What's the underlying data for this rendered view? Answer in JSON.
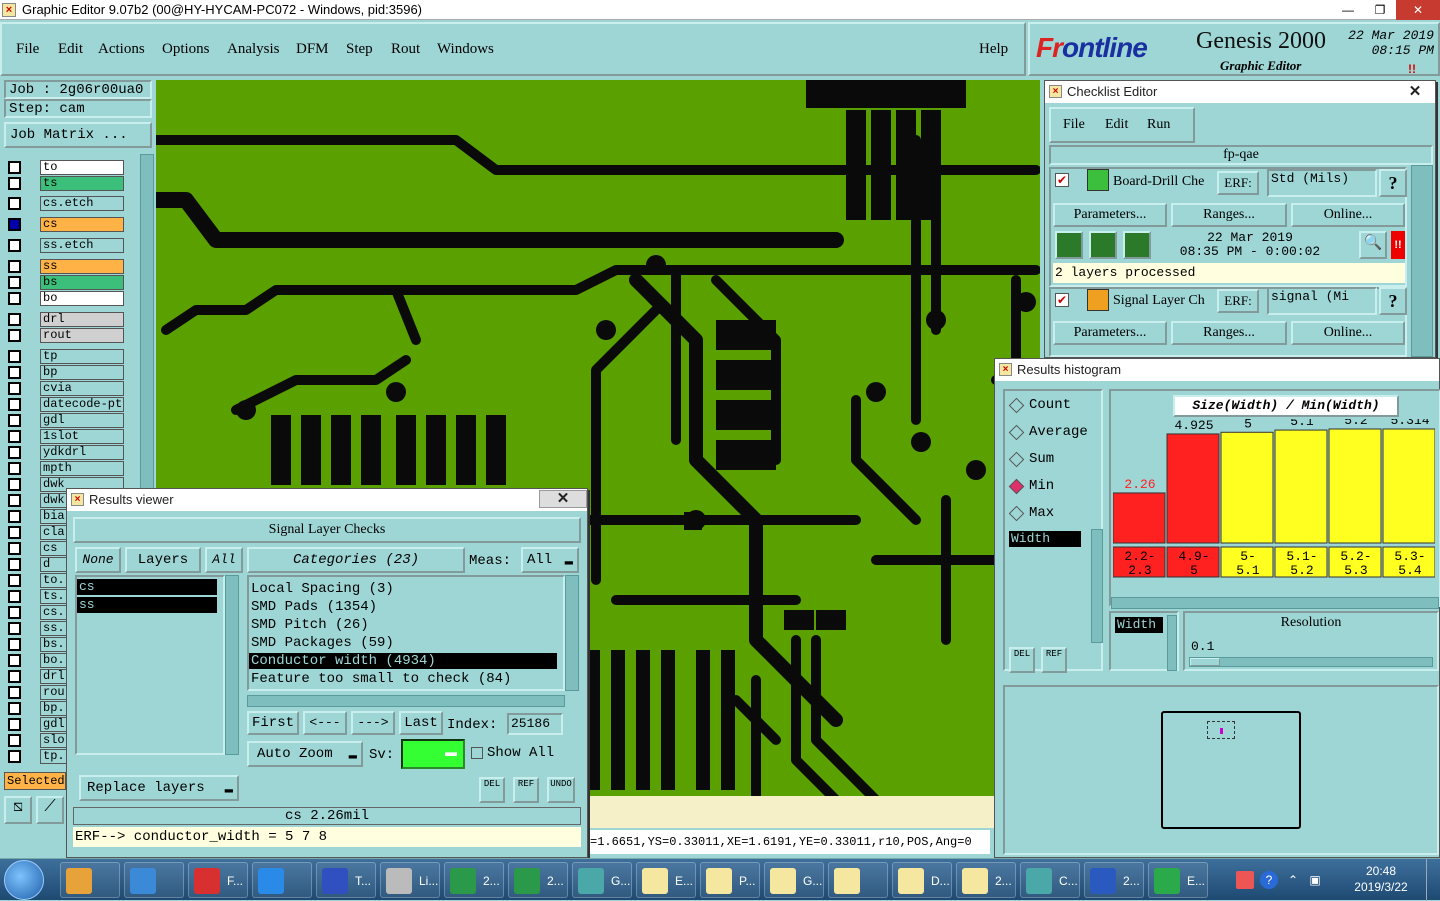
{
  "window": {
    "title": "Graphic Editor 9.07b2 (00@HY-HYCAM-PC072 - Windows, pid:3596)"
  },
  "menu": {
    "file": "File",
    "edit": "Edit",
    "actions": "Actions",
    "options": "Options",
    "analysis": "Analysis",
    "dfm": "DFM",
    "step": "Step",
    "rout": "Rout",
    "windows": "Windows",
    "help": "Help"
  },
  "brand": {
    "logo_a": "Fr",
    "logo_b": "ontline",
    "product": "Genesis 2000",
    "subtitle": "Graphic Editor",
    "date": "22 Mar 2019",
    "time": "08:15 PM",
    "mark": "!!"
  },
  "job": {
    "job": "Job : 2g06r00ua0",
    "step": "Step: cam",
    "matrix": "Job Matrix ...",
    "selected": "Selected"
  },
  "layers": [
    "to",
    "ts",
    "cs.etch",
    "cs",
    "ss.etch",
    "ss",
    "bs",
    "bo",
    "drl",
    "rout",
    "tp",
    "bp",
    "cvia",
    "datecode-pt",
    "gdl",
    "1slot",
    "ydkdrl",
    "mpth",
    "dwk",
    "dwk",
    "bia",
    "cla",
    "cs",
    "d",
    "to.",
    "ts.",
    "cs.",
    "ss.",
    "bs.",
    "bo.",
    "drl",
    "rou",
    "bp.",
    "gdl",
    "slo",
    "tp."
  ],
  "checklist": {
    "title": "Checklist Editor",
    "menu": {
      "file": "File",
      "edit": "Edit",
      "run": "Run"
    },
    "name": "fp-qae",
    "item1": {
      "name": "Board-Drill Che",
      "erf": "ERF:",
      "erf_val": "Std (Mils)",
      "help": "?",
      "params": "Parameters...",
      "ranges": "Ranges...",
      "online": "Online...",
      "date": "22 Mar 2019",
      "time": "08:35 PM - 0:00:02",
      "processed": "2 layers processed",
      "warn": "!!"
    },
    "item2": {
      "name": "Signal Layer Ch",
      "erf": "ERF:",
      "erf_val": "signal (Mi",
      "help": "?",
      "params": "Parameters...",
      "ranges": "Ranges...",
      "online": "Online..."
    }
  },
  "results_viewer": {
    "title": "Results viewer",
    "header": "Signal Layer Checks",
    "none": "None",
    "layers_label": "Layers",
    "all": "All",
    "categories": "Categories (23)",
    "meas": "Meas:",
    "meas_val": "All",
    "layer_list": [
      "cs",
      "ss"
    ],
    "category_list": [
      "Local Spacing (3)",
      "SMD Pads (1354)",
      "SMD Pitch (26)",
      "SMD Packages (59)",
      "Conductor width (4934)",
      "Feature too small to check (84)"
    ],
    "first": "First",
    "prev": "<---",
    "next": "--->",
    "last": "Last",
    "index_label": "Index:",
    "index_val": "25186",
    "auto_zoom": "Auto Zoom",
    "sv": "Sv:",
    "show_all": "Show All",
    "replace": "Replace layers",
    "del": "DEL",
    "ref": "REF",
    "undo": "UNDO",
    "current": "cs 2.26mil",
    "erf_line": "ERF--> conductor_width = 5 7 8"
  },
  "status_line": "=1.6651,YS=0.33011,XE=1.6191,YE=0.33011,r10,POS,Ang=0",
  "histogram": {
    "title": "Results histogram",
    "options": [
      "Count",
      "Average",
      "Sum",
      "Min",
      "Max"
    ],
    "selected_option": "Min",
    "field": "Width",
    "axis_title": "Size(Width) / Min(Width)",
    "resolution_label": "Resolution",
    "resolution_val": "0.1",
    "field2": "Width",
    "del": "DEL",
    "ref": "REF"
  },
  "chart_data": {
    "type": "bar",
    "title": "Size(Width) / Min(Width)",
    "categories": [
      "2.2-2.3",
      "4.9-5",
      "5-5.1",
      "5.1-5.2",
      "5.2-5.3",
      "5.3-5.4"
    ],
    "values": [
      2.26,
      4.925,
      5,
      5.1,
      5.2,
      5.314
    ],
    "value_labels": [
      "2.26",
      "4.925",
      "5",
      "5.1",
      "5.2",
      "5.314"
    ],
    "colors": [
      "#ff2020",
      "#ff2020",
      "#ffff20",
      "#ffff20",
      "#ffff20",
      "#ffff20"
    ],
    "ylim": [
      0,
      5.5
    ]
  },
  "taskbar": {
    "items": [
      "",
      "",
      "F...",
      "",
      "T...",
      "Li...",
      "2...",
      "2...",
      "G...",
      "E...",
      "P...",
      "G...",
      "",
      "D...",
      "2...",
      "C...",
      "2...",
      "E..."
    ],
    "clock_time": "20:48",
    "clock_date": "2019/3/22"
  },
  "colors": {
    "panel": "#9ed6d6",
    "board": "#5aa100",
    "trace": "#0a0a0a",
    "accent_red": "#ff2020",
    "accent_yellow": "#ffff20"
  }
}
